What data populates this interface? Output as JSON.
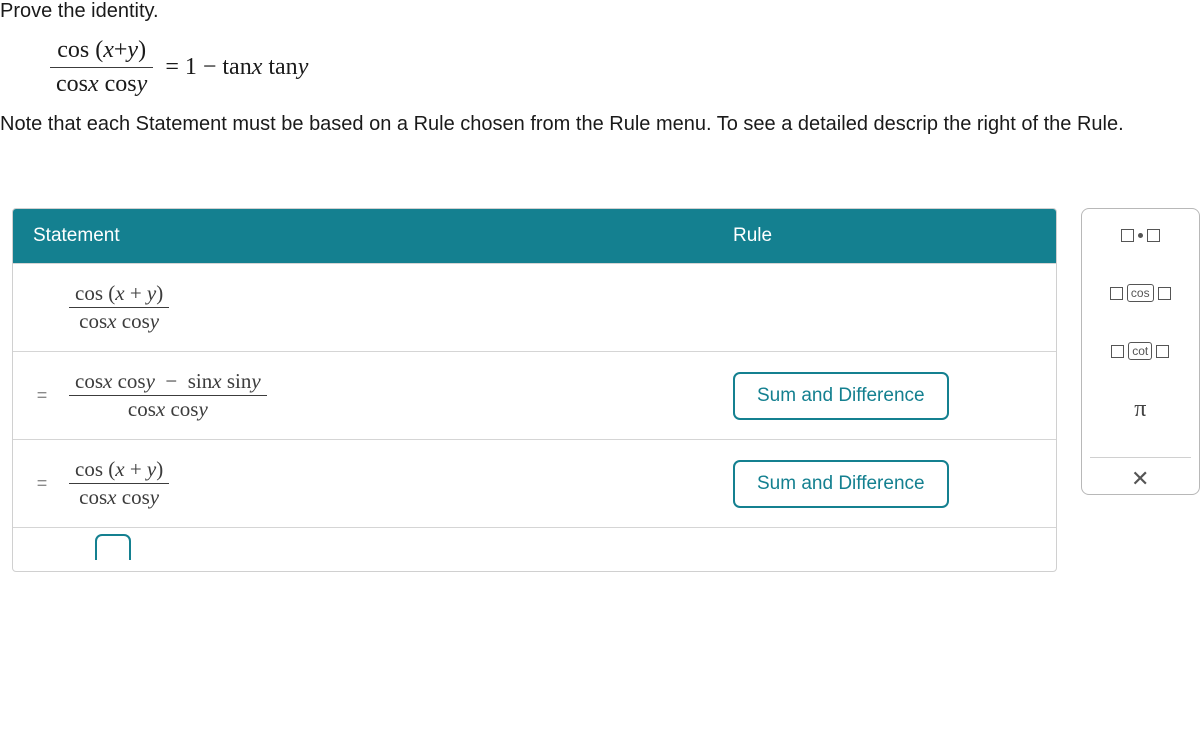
{
  "problem": {
    "prompt": "Prove the identity.",
    "identity_latex": "cos(x+y) / (cos x cos y) = 1 − tan x tan y",
    "note": "Note that each Statement must be based on a Rule chosen from the Rule menu. To see a detailed descrip the right of the Rule."
  },
  "table": {
    "header": {
      "statement": "Statement",
      "rule": "Rule"
    },
    "rows": [
      {
        "equals_prefix": "",
        "statement_latex": "cos(x + y) / (cos x cos y)",
        "rule": ""
      },
      {
        "equals_prefix": "=",
        "statement_latex": "(cos x cos y − sin x sin y) / (cos x cos y)",
        "rule": "Sum and Difference"
      },
      {
        "equals_prefix": "=",
        "statement_latex": "cos(x + y) / (cos x cos y)",
        "rule": "Sum and Difference"
      }
    ]
  },
  "rule_panel": {
    "rows": [
      {
        "kind": "sq-dot-sq"
      },
      {
        "kind": "trig",
        "label": "cos"
      },
      {
        "kind": "trig",
        "label": "cot"
      },
      {
        "kind": "pi",
        "label": "π"
      }
    ],
    "close_label": "×"
  }
}
